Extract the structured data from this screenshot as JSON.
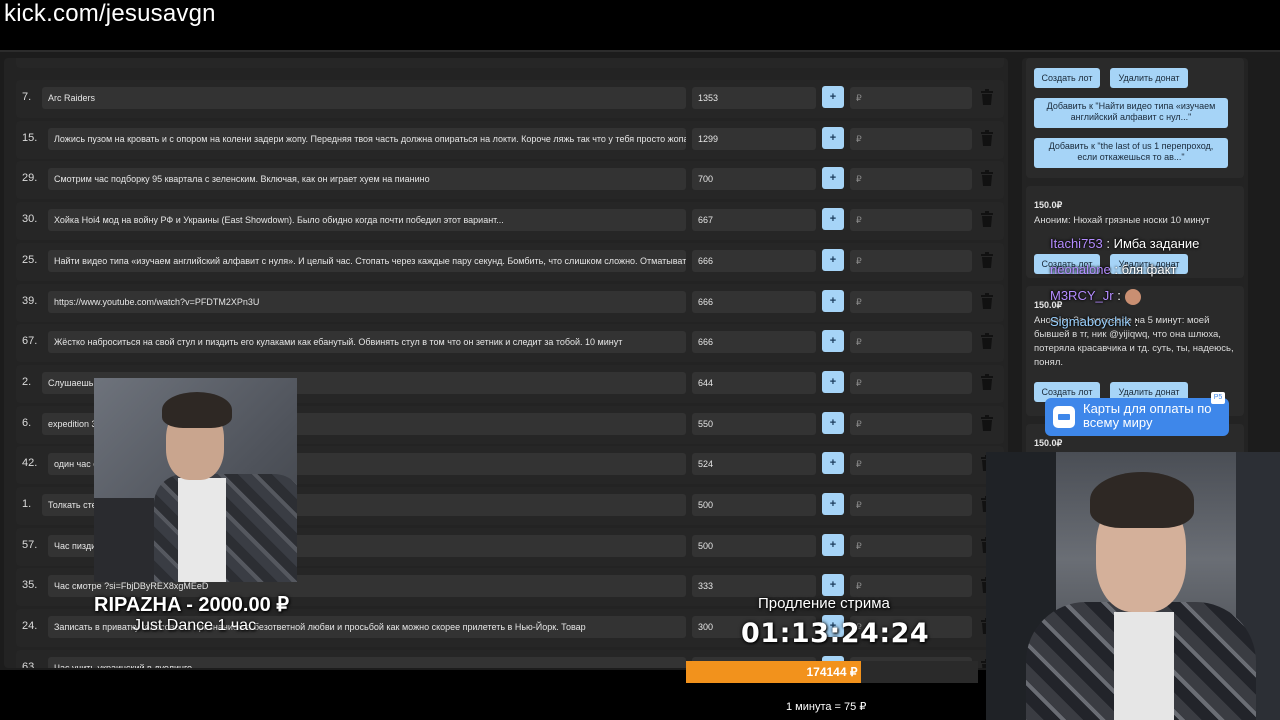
{
  "url": "kick.com/jesusavgn",
  "currency": "₽",
  "rows": [
    {
      "num": "7.",
      "title": "Arc Raiders",
      "amount": "1353"
    },
    {
      "num": "15.",
      "title": "Ложись пузом на кровать и с опором на колени задери жопу. Передняя твоя часть должна опираться на локти. Короче ляжь так что у тебя просто жопа т",
      "amount": "1299"
    },
    {
      "num": "29.",
      "title": "Смотрим час подборку 95 квартала с зеленским. Включая, как он играет хуем на пианино",
      "amount": "700"
    },
    {
      "num": "30.",
      "title": "Хойка Hoi4 мод на войну РФ и Украины (East Showdown). Было обидно когда почти победил этот вариант...",
      "amount": "667"
    },
    {
      "num": "25.",
      "title": "Найти видео типа «изучаем английский алфавит с нуля». И целый час. Стопать через каждые пару секунд. Бомбить, что слишком сложно. Отматывать",
      "amount": "666"
    },
    {
      "num": "39.",
      "title": "https://www.youtube.com/watch?v=PFDTM2XPn3U",
      "amount": "666"
    },
    {
      "num": "67.",
      "title": "Жёстко наброситься на свой стул и пиздить его кулаками как ебанутый. Обвинять стул в том что он зетник и следит за тобой. 10 минут",
      "amount": "666"
    },
    {
      "num": "2.",
      "title": "Слушаешь час те самые свои кринж треки. Попытка №2",
      "amount": "644"
    },
    {
      "num": "6.",
      "title": "expedition 33",
      "amount": "550"
    },
    {
      "num": "42.",
      "title": "один час сл",
      "amount": "524"
    },
    {
      "num": "1.",
      "title": "Толкать стен",
      "amount": "500"
    },
    {
      "num": "57.",
      "title": "Час пиздит",
      "amount": "500"
    },
    {
      "num": "35.",
      "title": "Час смотре                                          ?si=FbjDByREX8xgMEeD",
      "amount": "333"
    },
    {
      "num": "24.",
      "title": "Записать в приватку                                   голосовое с признанием в безответной любви и просьбой как можно скорее прилететь в Нью-Йорк. Товар",
      "amount": "300"
    },
    {
      "num": "63.",
      "title": "Час учить украинский в дуолинго",
      "amount": "300"
    }
  ],
  "right": {
    "create_lot": "Создать лот",
    "delete_donate": "Удалить донат",
    "add_to_1": "Добавить к \"Найти видео типа «изучаем английский алфавит с нул...\"",
    "add_to_2": "Добавить к \"the last of us 1 перепроход, если откажешься то ав...\"",
    "card1_price": "150.0₽",
    "card1_msg": "Аноним: Нюхай грязные носки 10 минут",
    "card2_price": "150.0₽",
    "card2_msg": "Аноним: За               голосовое на 5 минут: моей бывшей в тг, ник @yijiqwq, что она шлюха, потеряла красавчика и тд. суть, ты, надеюсь, понял.",
    "card3_price": "150.0₽"
  },
  "chat": [
    {
      "user": "Itachi753",
      "text": ": Имба задание"
    },
    {
      "user": "neonalone",
      "text": ": бля факт"
    },
    {
      "user": "M3RCY_Jr",
      "text": ":"
    },
    {
      "user": "Sigmaboychik",
      "text": ":"
    }
  ],
  "ad": {
    "text": "Карты для оплаты по всему миру",
    "tag": "Р5"
  },
  "alert": {
    "name": "RIPAZHA - 2000.00 ₽",
    "message": "Just Dance 1 час"
  },
  "extension": {
    "label": "Продление стрима",
    "time": "01:13:24:24",
    "progress_text": "174144 ₽",
    "progress_fraction": 0.6,
    "rate": "1 минута = 75 ₽"
  },
  "colors": {
    "accent_blue": "#a6d4f7",
    "progress_orange": "#f2921c",
    "chat_user": "#b48cff"
  }
}
